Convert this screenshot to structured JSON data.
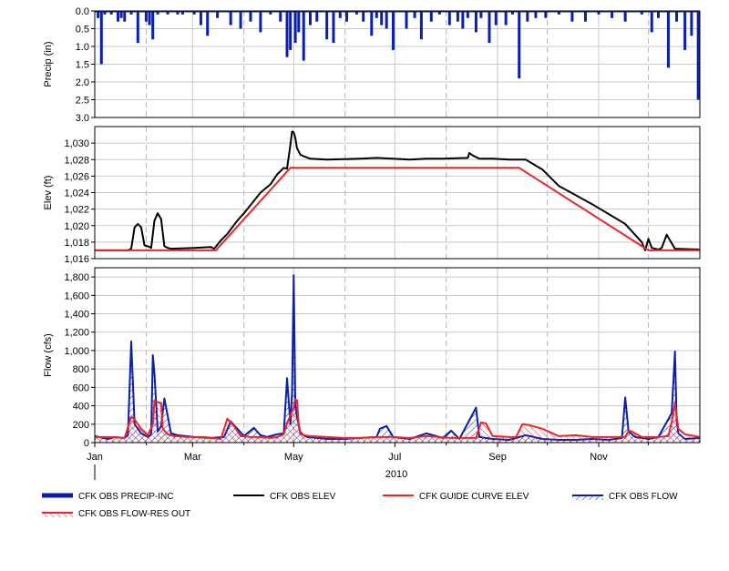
{
  "colors": {
    "precip": "#0b1fa8",
    "elev": "#000000",
    "guide": "#e8262b",
    "flow": "#0b1fa8",
    "flow_res_out": "#e8262b",
    "grid": "#c8c8c8",
    "axis": "#000000"
  },
  "chart_data": [
    {
      "type": "bar",
      "panel": "precip",
      "ylabel": "Precip (in)",
      "ylim": [
        0,
        3.0
      ],
      "y_inverted": true,
      "yticks": [
        "0.0",
        "0.5",
        "1.0",
        "1.5",
        "2.0",
        "2.5",
        "3.0"
      ],
      "ytick_values": [
        0,
        0.5,
        1.0,
        1.5,
        2.0,
        2.5,
        3.0
      ],
      "series": [
        {
          "name": "CFK OBS PRECIP-INC",
          "x_day": [
            2,
            4,
            6,
            10,
            14,
            16,
            18,
            22,
            26,
            31,
            33,
            35,
            38,
            44,
            50,
            53,
            60,
            64,
            68,
            74,
            82,
            88,
            94,
            100,
            106,
            112,
            116,
            118,
            121,
            123,
            126,
            130,
            134,
            140,
            144,
            148,
            152,
            158,
            162,
            167,
            170,
            173,
            176,
            180,
            188,
            193,
            197,
            203,
            208,
            214,
            219,
            222,
            225,
            230,
            233,
            238,
            242,
            248,
            252,
            256,
            261,
            266,
            272,
            280,
            288,
            296,
            304,
            312,
            320,
            330,
            336,
            340,
            346,
            351,
            356,
            360,
            364
          ],
          "values": [
            0.2,
            1.5,
            0.1,
            0.1,
            0.3,
            0.2,
            0.3,
            0.1,
            0.9,
            0.3,
            0.4,
            0.8,
            0.1,
            0.1,
            0.1,
            0.1,
            0.1,
            0.4,
            0.7,
            0.2,
            0.4,
            0.5,
            0.3,
            0.6,
            0.1,
            0.3,
            1.3,
            1.1,
            0.9,
            0.6,
            1.4,
            0.4,
            0.3,
            0.8,
            0.9,
            0.2,
            0.3,
            0.1,
            0.3,
            0.7,
            0.2,
            0.4,
            0.5,
            1.1,
            0.5,
            0.2,
            0.8,
            0.3,
            0.1,
            0.4,
            0.3,
            0.5,
            0.2,
            0.6,
            0.2,
            0.9,
            0.4,
            0.4,
            0.1,
            1.9,
            0.3,
            0.2,
            0.2,
            0.1,
            0.3,
            0.3,
            0.1,
            0.2,
            0.3,
            0.1,
            0.6,
            0.2,
            1.6,
            0.3,
            1.1,
            0.7,
            2.5
          ]
        }
      ]
    },
    {
      "type": "line",
      "panel": "elev",
      "ylabel": "Elev (ft)",
      "ylim": [
        1016,
        1032
      ],
      "yticks": [
        "1,016",
        "1,018",
        "1,020",
        "1,022",
        "1,024",
        "1,026",
        "1,028",
        "1,030"
      ],
      "ytick_values": [
        1016,
        1018,
        1020,
        1022,
        1024,
        1026,
        1028,
        1030
      ],
      "series": [
        {
          "name": "CFK OBS ELEV",
          "x_day": [
            0,
            20,
            22,
            24,
            26,
            28,
            30,
            32,
            34,
            36,
            38,
            40,
            42,
            44,
            46,
            60,
            70,
            72,
            76,
            80,
            86,
            90,
            96,
            100,
            106,
            110,
            114,
            116,
            118,
            119,
            120,
            121,
            122,
            124,
            126,
            130,
            140,
            160,
            170,
            180,
            190,
            200,
            210,
            225,
            226,
            228,
            232,
            240,
            250,
            256,
            260,
            270,
            280,
            300,
            320,
            330,
            332,
            334,
            336,
            340,
            342,
            345,
            350,
            365
          ],
          "values": [
            1017,
            1017,
            1017.2,
            1019.8,
            1020.2,
            1019.8,
            1017.6,
            1017.5,
            1017.3,
            1020.6,
            1021.5,
            1020.8,
            1017.5,
            1017.3,
            1017.2,
            1017.3,
            1017.4,
            1017.2,
            1018.2,
            1019.0,
            1020.6,
            1021.5,
            1023.0,
            1024.0,
            1025.0,
            1026.2,
            1027.0,
            1026.9,
            1029.8,
            1031.4,
            1031.3,
            1030.6,
            1029.4,
            1028.6,
            1028.4,
            1028.1,
            1028.0,
            1028.1,
            1028.2,
            1028.1,
            1028.0,
            1028.1,
            1028.1,
            1028.2,
            1028.8,
            1028.5,
            1028.1,
            1028.1,
            1028.0,
            1028.0,
            1028.0,
            1026.8,
            1024.8,
            1022.6,
            1020.2,
            1018.0,
            1017.0,
            1018.4,
            1017.3,
            1017.1,
            1017.3,
            1018.9,
            1017.2,
            1017.1
          ]
        },
        {
          "name": "CFK GUIDE CURVE ELEV",
          "x_day": [
            0,
            73,
            118,
            256,
            334,
            365
          ],
          "values": [
            1017,
            1017,
            1027,
            1027,
            1017,
            1017
          ]
        }
      ]
    },
    {
      "type": "area",
      "panel": "flow",
      "ylabel": "Flow (cfs)",
      "ylim": [
        0,
        1900
      ],
      "yticks": [
        "0",
        "200",
        "400",
        "600",
        "800",
        "1,000",
        "1,200",
        "1,400",
        "1,600",
        "1,800"
      ],
      "ytick_values": [
        0,
        200,
        400,
        600,
        800,
        1000,
        1200,
        1400,
        1600,
        1800
      ],
      "x_axis": {
        "ticks": [
          "Jan",
          "Mar",
          "May",
          "Jul",
          "Sep",
          "Nov"
        ],
        "tick_days": [
          0,
          59,
          120,
          181,
          243,
          304
        ],
        "minor_tick_days": [
          31,
          90,
          151,
          212,
          273,
          334
        ],
        "year_label": "2010",
        "domain_days": [
          0,
          365
        ]
      },
      "series": [
        {
          "name": "CFK OBS FLOW",
          "x_day": [
            0,
            8,
            12,
            18,
            20,
            21,
            22,
            24,
            28,
            32,
            34,
            35,
            36,
            38,
            40,
            42,
            46,
            50,
            60,
            70,
            78,
            82,
            86,
            90,
            96,
            100,
            104,
            110,
            114,
            116,
            118,
            119,
            120,
            121,
            122,
            124,
            128,
            134,
            140,
            150,
            160,
            170,
            172,
            176,
            180,
            190,
            200,
            210,
            215,
            220,
            230,
            232,
            240,
            250,
            260,
            270,
            280,
            290,
            300,
            310,
            318,
            320,
            322,
            326,
            330,
            334,
            340,
            348,
            350,
            351,
            352,
            356,
            365
          ],
          "values": [
            70,
            40,
            60,
            50,
            80,
            600,
            1100,
            200,
            100,
            60,
            90,
            950,
            750,
            120,
            180,
            480,
            100,
            80,
            60,
            50,
            60,
            230,
            150,
            70,
            160,
            80,
            60,
            90,
            100,
            700,
            200,
            550,
            1820,
            400,
            280,
            100,
            60,
            50,
            40,
            40,
            50,
            60,
            150,
            180,
            60,
            40,
            100,
            50,
            130,
            40,
            380,
            60,
            40,
            30,
            80,
            40,
            30,
            30,
            40,
            30,
            50,
            490,
            120,
            60,
            50,
            40,
            60,
            320,
            990,
            250,
            100,
            40,
            50
          ]
        },
        {
          "name": "CFK OBS FLOW-RES OUT",
          "x_day": [
            0,
            10,
            18,
            22,
            24,
            28,
            32,
            35,
            36,
            38,
            40,
            41,
            44,
            48,
            56,
            66,
            76,
            80,
            84,
            88,
            94,
            100,
            106,
            110,
            114,
            116,
            118,
            120,
            121,
            122,
            123,
            124,
            126,
            130,
            140,
            150,
            160,
            170,
            180,
            190,
            200,
            215,
            230,
            233,
            236,
            240,
            250,
            254,
            256,
            258,
            262,
            270,
            280,
            290,
            300,
            310,
            320,
            322,
            324,
            330,
            340,
            346,
            348,
            350,
            352,
            356,
            365
          ],
          "values": [
            60,
            60,
            50,
            280,
            250,
            150,
            80,
            200,
            450,
            440,
            430,
            150,
            90,
            70,
            60,
            60,
            40,
            260,
            180,
            70,
            60,
            60,
            50,
            60,
            90,
            210,
            300,
            380,
            470,
            460,
            200,
            120,
            80,
            70,
            60,
            50,
            50,
            60,
            60,
            50,
            70,
            50,
            50,
            220,
            210,
            70,
            60,
            60,
            130,
            200,
            190,
            150,
            70,
            80,
            60,
            60,
            60,
            130,
            120,
            60,
            60,
            70,
            220,
            430,
            150,
            90,
            60
          ]
        }
      ]
    }
  ],
  "legend": [
    {
      "name": "CFK OBS PRECIP-INC",
      "style": "thick-line"
    },
    {
      "name": "CFK OBS ELEV",
      "style": "line"
    },
    {
      "name": "CFK GUIDE CURVE ELEV",
      "style": "line"
    },
    {
      "name": "CFK OBS FLOW",
      "style": "hatched-area"
    },
    {
      "name": "CFK OBS FLOW-RES OUT",
      "style": "hatched-area"
    }
  ]
}
